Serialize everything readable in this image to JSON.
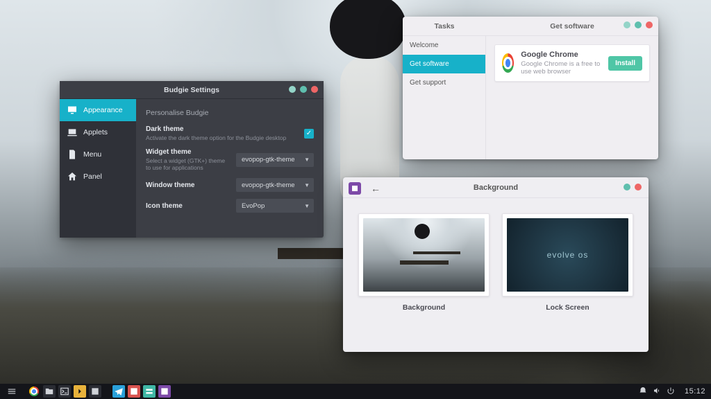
{
  "budgie": {
    "title": "Budgie Settings",
    "sidebar": [
      {
        "id": "appearance",
        "label": "Appearance"
      },
      {
        "id": "applets",
        "label": "Applets"
      },
      {
        "id": "menu",
        "label": "Menu"
      },
      {
        "id": "panel",
        "label": "Panel"
      }
    ],
    "heading": "Personalise Budgie",
    "rows": {
      "dark": {
        "label": "Dark theme",
        "sub": "Activate the dark theme option for the Budgie desktop",
        "checked": true
      },
      "widget": {
        "label": "Widget theme",
        "sub": "Select a widget (GTK+) theme to use for applications",
        "value": "evopop-gtk-theme"
      },
      "window": {
        "label": "Window theme",
        "sub": "",
        "value": "evopop-gtk-theme"
      },
      "icon": {
        "label": "Icon theme",
        "sub": "",
        "value": "EvoPop"
      }
    }
  },
  "getSoftware": {
    "tabs": {
      "tasks": "Tasks",
      "main": "Get software"
    },
    "sidebar": [
      {
        "id": "welcome",
        "label": "Welcome"
      },
      {
        "id": "software",
        "label": "Get software"
      },
      {
        "id": "support",
        "label": "Get support"
      }
    ],
    "app": {
      "name": "Google Chrome",
      "desc": "Google Chrome is a free to use web browser",
      "install": "Install"
    }
  },
  "background": {
    "title": "Background",
    "cards": {
      "wall": "Background",
      "lock": "Lock Screen"
    },
    "lockText": "evolve os"
  },
  "taskbar": {
    "clock": "15:12"
  }
}
